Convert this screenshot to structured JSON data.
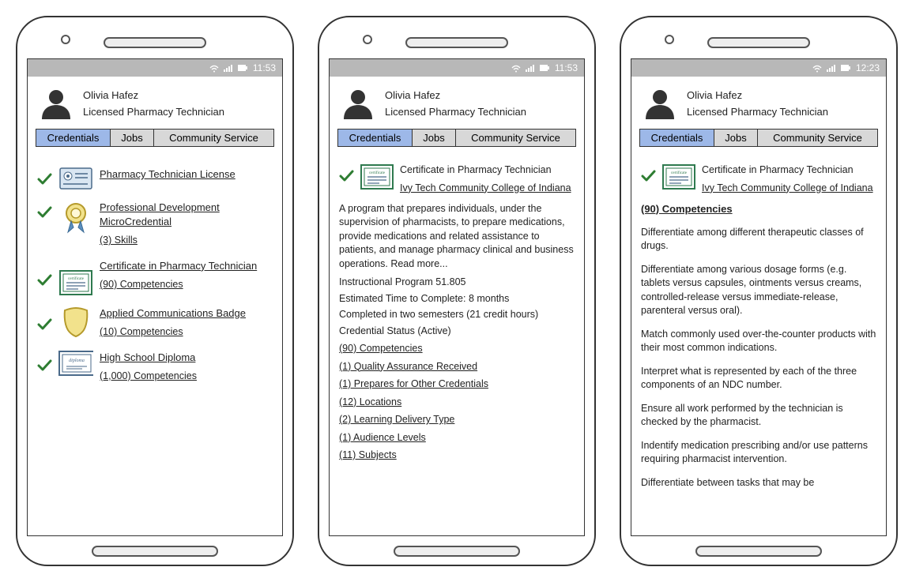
{
  "status_time_a": "11:53",
  "status_time_b": "12:23",
  "profile": {
    "name": "Olivia Hafez",
    "title": "Licensed Pharmacy Technician"
  },
  "tabs": {
    "credentials": "Credentials",
    "jobs": "Jobs",
    "community": "Community Service"
  },
  "screen1": {
    "items": [
      {
        "title": "Pharmacy Technician License",
        "sub": ""
      },
      {
        "title": "Professional Development MicroCredential",
        "sub": "(3) Skills"
      },
      {
        "title": "Certificate in Pharmacy Technician",
        "sub": "(90) Competencies"
      },
      {
        "title": "Applied Communications Badge",
        "sub": "(10) Competencies"
      },
      {
        "title": "High School Diploma",
        "sub": "(1,000) Competencies"
      }
    ]
  },
  "screen2": {
    "cert_title": "Certificate in Pharmacy Technician",
    "institution": "Ivy Tech Community College of Indiana",
    "description": "A program that prepares individuals, under the supervision of pharmacists, to prepare medications, provide medications and related assistance to patients, and manage pharmacy clinical and business operations. Read more...",
    "program_line": "Instructional Program 51.805",
    "time_line": "Estimated Time to Complete: 8 months",
    "completed_line": "Completed in two semesters (21 credit hours)",
    "status_line": "Credential Status (Active)",
    "links": [
      "(90) Competencies",
      "(1) Quality Assurance Received",
      "(1) Prepares for Other Credentials",
      "(12) Locations",
      "(2) Learning Delivery Type",
      "(1) Audience Levels",
      "(11) Subjects"
    ]
  },
  "screen3": {
    "cert_title": "Certificate in Pharmacy Technician",
    "institution": "Ivy Tech Community College of Indiana",
    "comp_header": "(90) Competencies",
    "competencies": [
      "Differentiate among different therapeutic classes of drugs.",
      "Differentiate among various dosage forms (e.g. tablets versus capsules, ointments versus creams, controlled-release versus immediate-release, parenteral versus oral).",
      "Match commonly used over-the-counter products with their most common indications.",
      "Interpret what is represented by each of the three components of an NDC number.",
      "Ensure all work performed by the technician is checked by the pharmacist.",
      "Indentify medication prescribing and/or use patterns requiring pharmacist intervention.",
      "Differentiate between tasks that may be"
    ]
  }
}
